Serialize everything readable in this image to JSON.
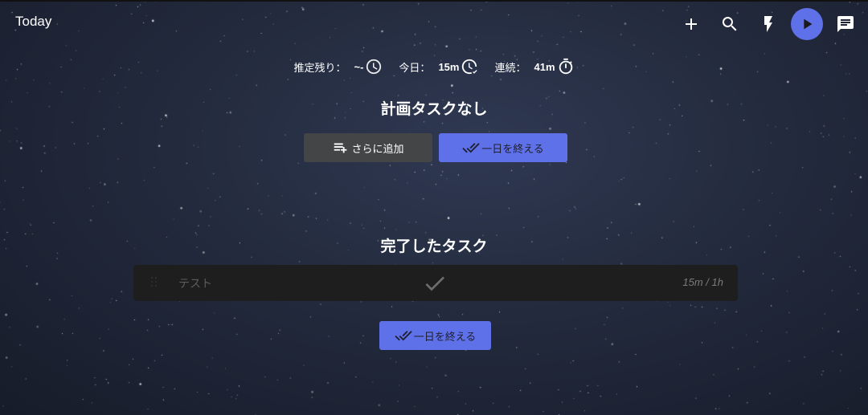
{
  "app": {
    "title": "Today"
  },
  "toolbar": {
    "icons": [
      "add-icon",
      "search-icon",
      "flash-icon",
      "play-icon",
      "chat-icon"
    ],
    "play_color": "#5f71e8"
  },
  "stats": {
    "estimate_label": "推定残り：",
    "estimate_value": "~-",
    "today_label": "今日：",
    "today_value": "15m",
    "streak_label": "連続：",
    "streak_value": "41m"
  },
  "planned": {
    "heading": "計画タスクなし",
    "add_more_label": "さらに追加",
    "finish_day_label": "一日を終える"
  },
  "done": {
    "heading": "完了したタスク",
    "tasks": [
      {
        "name": "テスト",
        "time": "15m / 1h"
      }
    ],
    "finish_day_label": "一日を終える"
  },
  "colors": {
    "accent": "#5f71e8",
    "dark_button": "#444546",
    "task_bg": "#1e1e1f"
  }
}
